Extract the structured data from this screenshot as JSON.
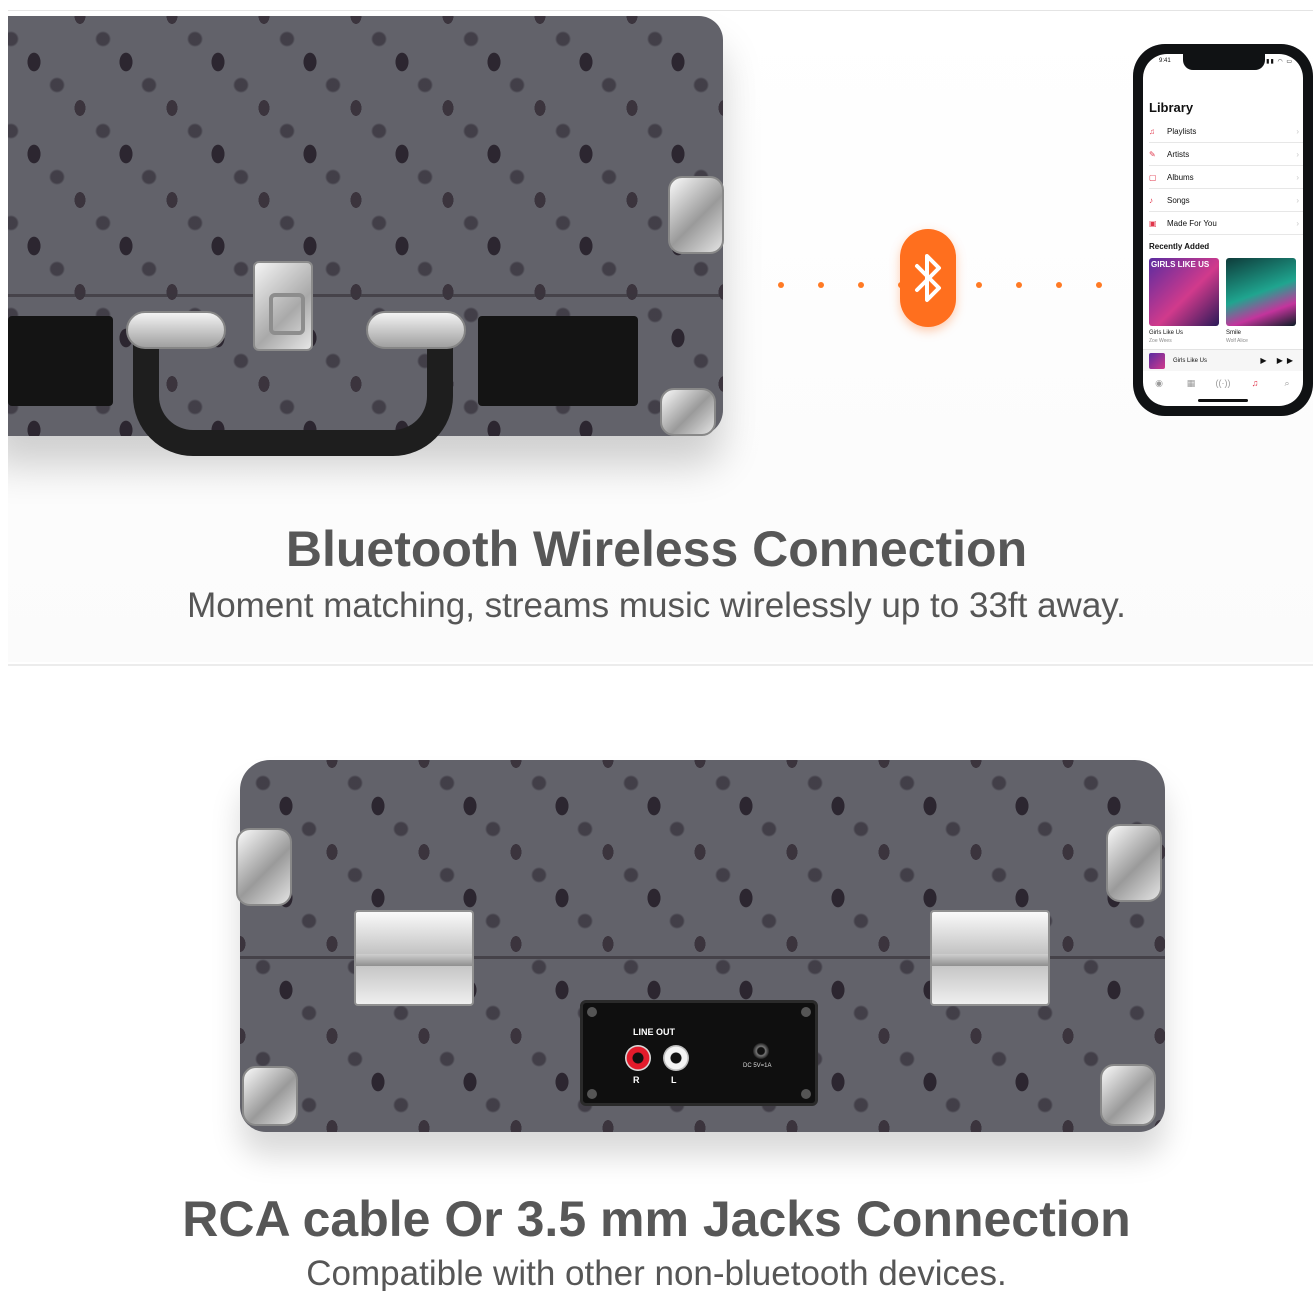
{
  "headline_bluetooth": "Bluetooth Wireless Connection",
  "subline_bluetooth": "Moment matching, streams music wirelessly up to 33ft away.",
  "headline_rca": "RCA cable Or 3.5 mm Jacks Connection",
  "subline_rca": "Compatible with other non-bluetooth devices.",
  "colors": {
    "accent": "#ff6f1e",
    "text": "#575757",
    "music_red": "#e0364b"
  },
  "icons": [
    "bluetooth-icon",
    "playlists-icon",
    "artists-icon",
    "albums-icon",
    "songs-icon",
    "made-for-you-icon",
    "play-icon",
    "forward-icon",
    "search-icon"
  ],
  "phone": {
    "time": "9:41",
    "title": "Library",
    "items": [
      {
        "label": "Playlists",
        "icon": "♫"
      },
      {
        "label": "Artists",
        "icon": "✎"
      },
      {
        "label": "Albums",
        "icon": "▢"
      },
      {
        "label": "Songs",
        "icon": "♪"
      },
      {
        "label": "Made For You",
        "icon": "▣"
      }
    ],
    "recent_title": "Recently Added",
    "albums": [
      {
        "art_text": "GIRLS LIKE US",
        "title": "Girls Like Us",
        "artist": "Zoe Wees"
      },
      {
        "title": "Smile",
        "artist": "Wolf Alice"
      }
    ],
    "now_playing": "Girls Like Us",
    "controls": "▶ ▶▶",
    "tabs": [
      "◉",
      "▦",
      "((·))",
      "♫",
      "⌕"
    ]
  },
  "jack_panel": {
    "label": "LINE OUT",
    "r": "R",
    "l": "L",
    "dc": "DC 5V=1A"
  }
}
